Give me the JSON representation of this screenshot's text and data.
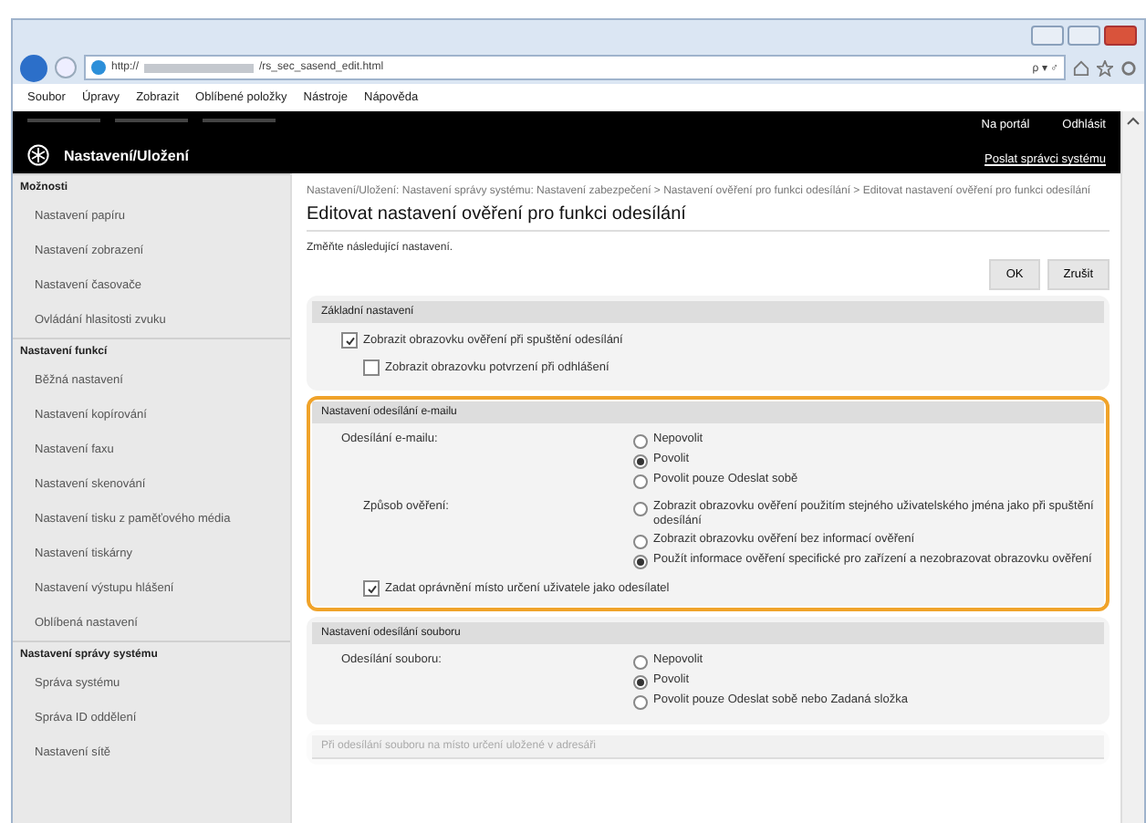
{
  "browser": {
    "url_start": "http://",
    "url_end": "/rs_sec_sasend_edit.html",
    "search_glyph": "ρ ▾ ♂"
  },
  "menu_bar": [
    "Soubor",
    "Úpravy",
    "Zobrazit",
    "Oblíbené položky",
    "Nástroje",
    "Nápověda"
  ],
  "header": {
    "title": "Nastavení/Uložení",
    "links": [
      "Na portál",
      "Odhlásit"
    ],
    "mail_link": "Poslat správci systému"
  },
  "sidebar": [
    {
      "heading": "Možnosti",
      "items": [
        "Nastavení papíru",
        "Nastavení zobrazení",
        "Nastavení časovače",
        "Ovládání hlasitosti zvuku"
      ]
    },
    {
      "heading": "Nastavení funkcí",
      "items": [
        "Běžná nastavení",
        "Nastavení kopírování",
        "Nastavení faxu",
        "Nastavení skenování",
        "Nastavení tisku z paměťového média",
        "Nastavení tiskárny",
        "Nastavení výstupu hlášení",
        "Oblíbená nastavení"
      ]
    },
    {
      "heading": "Nastavení správy systému",
      "items": [
        "Správa systému",
        "Správa ID oddělení",
        "Nastavení sítě"
      ]
    }
  ],
  "breadcrumb": "Nastavení/Uložení: Nastavení správy systému: Nastavení zabezpečení > Nastavení ověření pro funkci odesílání > Editovat nastavení ověření pro funkci odesílání",
  "page_title": "Editovat nastavení ověření pro funkci odesílání",
  "description": "Změňte následující nastavení.",
  "buttons": [
    "OK",
    "Zrušit"
  ],
  "sections": [
    {
      "title": "Základní nastavení",
      "highlighted": false,
      "disabled": false,
      "rows": [
        {
          "kind": "checkbox",
          "label": "Zobrazit obrazovku ověření při spuštění odesílání",
          "checked": true,
          "children": [
            {
              "kind": "checkbox",
              "label": "Zobrazit obrazovku potvrzení při odhlášení",
              "checked": false
            }
          ]
        }
      ]
    },
    {
      "title": "Nastavení odesílání e-mailu",
      "highlighted": true,
      "disabled": false,
      "rows": [
        {
          "kind": "radio-group",
          "label": "Odesílání e-mailu:",
          "options": [
            {
              "label": "Nepovolit",
              "selected": false
            },
            {
              "label": "Povolit",
              "selected": true
            },
            {
              "label": "Povolit pouze Odeslat sobě",
              "selected": false
            }
          ],
          "children": [
            {
              "kind": "radio-group",
              "label": "Způsob ověření:",
              "options": [
                {
                  "label": "Zobrazit obrazovku ověření použitím stejného uživatelského jména jako při spuštění odesílání",
                  "selected": false
                },
                {
                  "label": "Zobrazit obrazovku ověření bez informací ověření",
                  "selected": false
                },
                {
                  "label": "Použít informace ověření specifické pro zařízení a nezobrazovat obrazovku ověření",
                  "selected": true
                }
              ]
            },
            {
              "kind": "checkbox",
              "label": "Zadat oprávnění místo určení uživatele jako odesílatel",
              "checked": true
            }
          ]
        }
      ]
    },
    {
      "title": "Nastavení odesílání souboru",
      "highlighted": false,
      "disabled": false,
      "rows": [
        {
          "kind": "radio-group",
          "label": "Odesílání souboru:",
          "options": [
            {
              "label": "Nepovolit",
              "selected": false
            },
            {
              "label": "Povolit",
              "selected": true
            },
            {
              "label": "Povolit pouze Odeslat sobě nebo Zadaná složka",
              "selected": false
            }
          ]
        }
      ]
    },
    {
      "title": "Při odesílání souboru na místo určení uložené v adresáři",
      "highlighted": false,
      "disabled": true
    }
  ]
}
